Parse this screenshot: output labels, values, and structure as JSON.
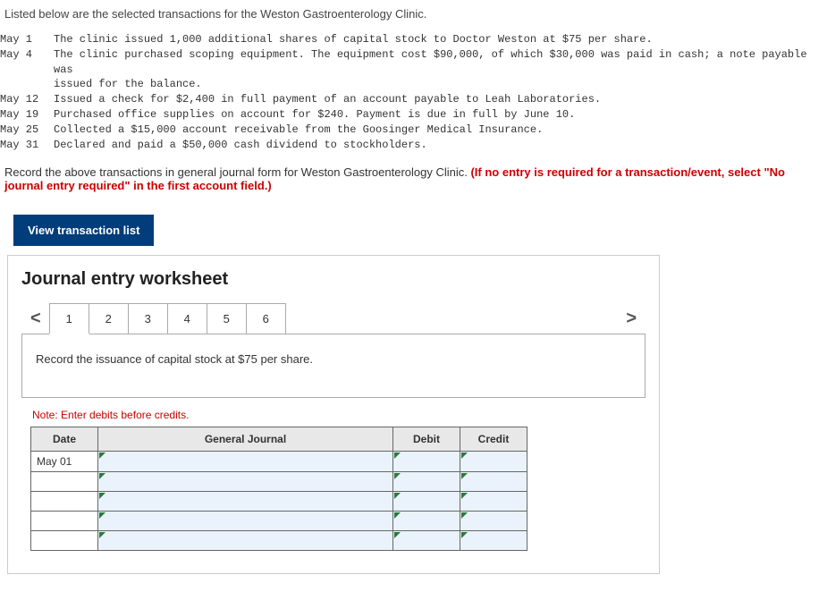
{
  "intro": "Listed below are the selected transactions for the Weston Gastroenterology Clinic.",
  "transactions": [
    {
      "date": "May  1",
      "desc": "The clinic issued 1,000 additional shares of capital stock to Doctor Weston at $75 per share."
    },
    {
      "date": "May  4",
      "desc": "The clinic purchased scoping equipment. The equipment cost $90,000, of which $30,000 was paid in cash; a note payable was",
      "cont": "issued for the balance."
    },
    {
      "date": "May 12",
      "desc": "Issued a check for $2,400 in full payment of an account payable to Leah Laboratories."
    },
    {
      "date": "May 19",
      "desc": "Purchased office supplies on account for $240. Payment is due in full by June 10."
    },
    {
      "date": "May 25",
      "desc": "Collected a $15,000 account receivable from the Goosinger Medical Insurance."
    },
    {
      "date": "May 31",
      "desc": "Declared and paid a $50,000 cash dividend to stockholders."
    }
  ],
  "instructions_main": "Record the above transactions in general journal form for Weston Gastroenterology Clinic. ",
  "instructions_red": "(If no entry is required for a transaction/event, select \"No journal entry required\" in the first account field.)",
  "view_btn": "View transaction list",
  "worksheet_title": "Journal entry worksheet",
  "tabs": [
    "1",
    "2",
    "3",
    "4",
    "5",
    "6"
  ],
  "active_instruction": "Record the issuance of capital stock at $75 per share.",
  "note": "Note: Enter debits before credits.",
  "table_headers": {
    "date": "Date",
    "gj": "General Journal",
    "debit": "Debit",
    "credit": "Credit"
  },
  "row_date": "May 01",
  "nav_left": "<",
  "nav_right": ">"
}
